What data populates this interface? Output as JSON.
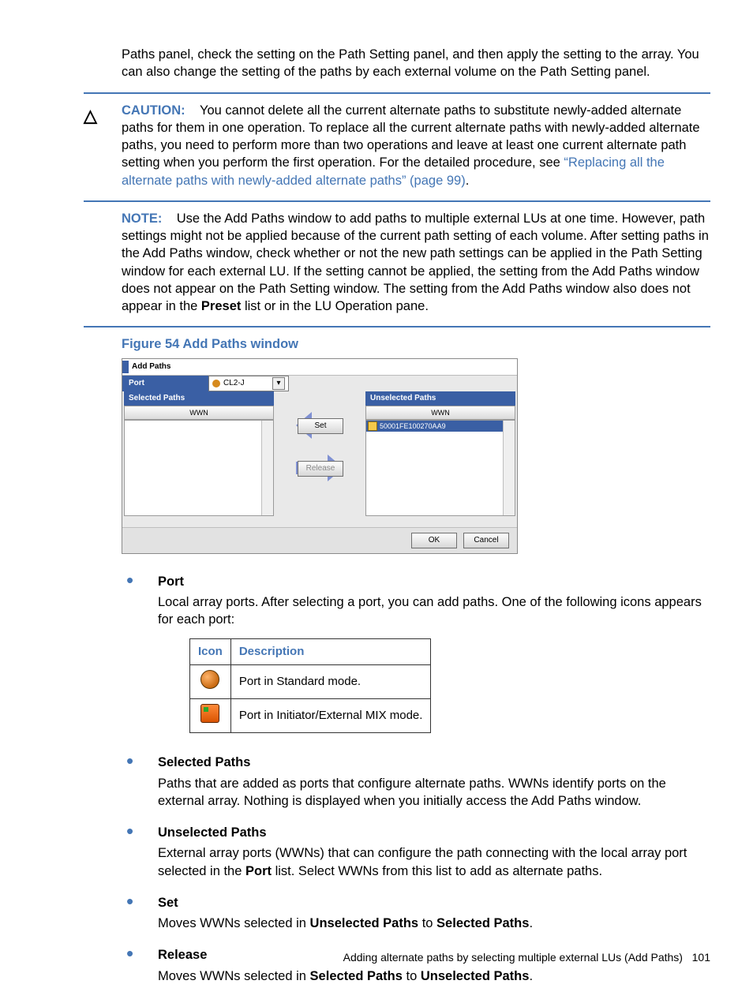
{
  "intro": "Paths panel, check the setting on the Path Setting panel, and then apply the setting to the array. You can also change the setting of the paths by each external volume on the Path Setting panel.",
  "caution": {
    "label": "CAUTION:",
    "text_before_link": "You cannot delete all the current alternate paths to substitute newly-added alternate paths for them in one operation. To replace all the current alternate paths with newly-added alternate paths, you need to perform more than two operations and leave at least one current alternate path setting when you perform the first operation. For the detailed procedure, see ",
    "link": "“Replacing all the alternate paths with newly-added alternate paths” (page 99)",
    "after_link": "."
  },
  "note": {
    "label": "NOTE:",
    "text_a": "Use the Add Paths window to add paths to multiple external LUs at one time. However, path settings might not be applied because of the current path setting of each volume. After setting paths in the Add Paths window, check whether or not the new path settings can be applied in the Path Setting window for each external LU. If the setting cannot be applied, the setting from the Add Paths window does not appear on the Path Setting window. The setting from the Add Paths window also does not appear in the ",
    "preset": "Preset",
    "text_b": " list or in the LU Operation pane."
  },
  "figure_title": "Figure 54 Add Paths window",
  "shot": {
    "title": "Add Paths",
    "port_label": "Port",
    "port_value": "CL2-J",
    "selected_hdr": "Selected Paths",
    "unselected_hdr": "Unselected Paths",
    "wwn": "WWN",
    "entry": "50001FE100270AA9",
    "set": "Set",
    "release": "Release",
    "ok": "OK",
    "cancel": "Cancel"
  },
  "bullets": {
    "port": {
      "head": "Port",
      "desc": "Local array ports. After selecting a port, you can add paths. One of the following icons appears for each port:"
    },
    "table": {
      "h1": "Icon",
      "h2": "Description",
      "r1": "Port in Standard mode.",
      "r2": "Port in Initiator/External MIX mode."
    },
    "selected": {
      "head": "Selected Paths",
      "desc": "Paths that are added as ports that configure alternate paths. WWNs identify ports on the external array. Nothing is displayed when you initially access the Add Paths window."
    },
    "unselected": {
      "head": "Unselected Paths",
      "desc_a": "External array ports (WWNs) that can configure the path connecting with the local array port selected in the ",
      "port_b": "Port",
      "desc_b": " list. Select WWNs from this list to add as alternate paths."
    },
    "set": {
      "head": "Set",
      "desc_a": "Moves WWNs selected in ",
      "b1": "Unselected Paths",
      "mid": " to ",
      "b2": "Selected Paths",
      "end": "."
    },
    "release": {
      "head": "Release",
      "desc_a": "Moves WWNs selected in ",
      "b1": "Selected Paths",
      "mid": " to ",
      "b2": "Unselected Paths",
      "end": "."
    }
  },
  "footer": {
    "text": "Adding alternate paths by selecting multiple external LUs (Add Paths)",
    "page": "101"
  }
}
